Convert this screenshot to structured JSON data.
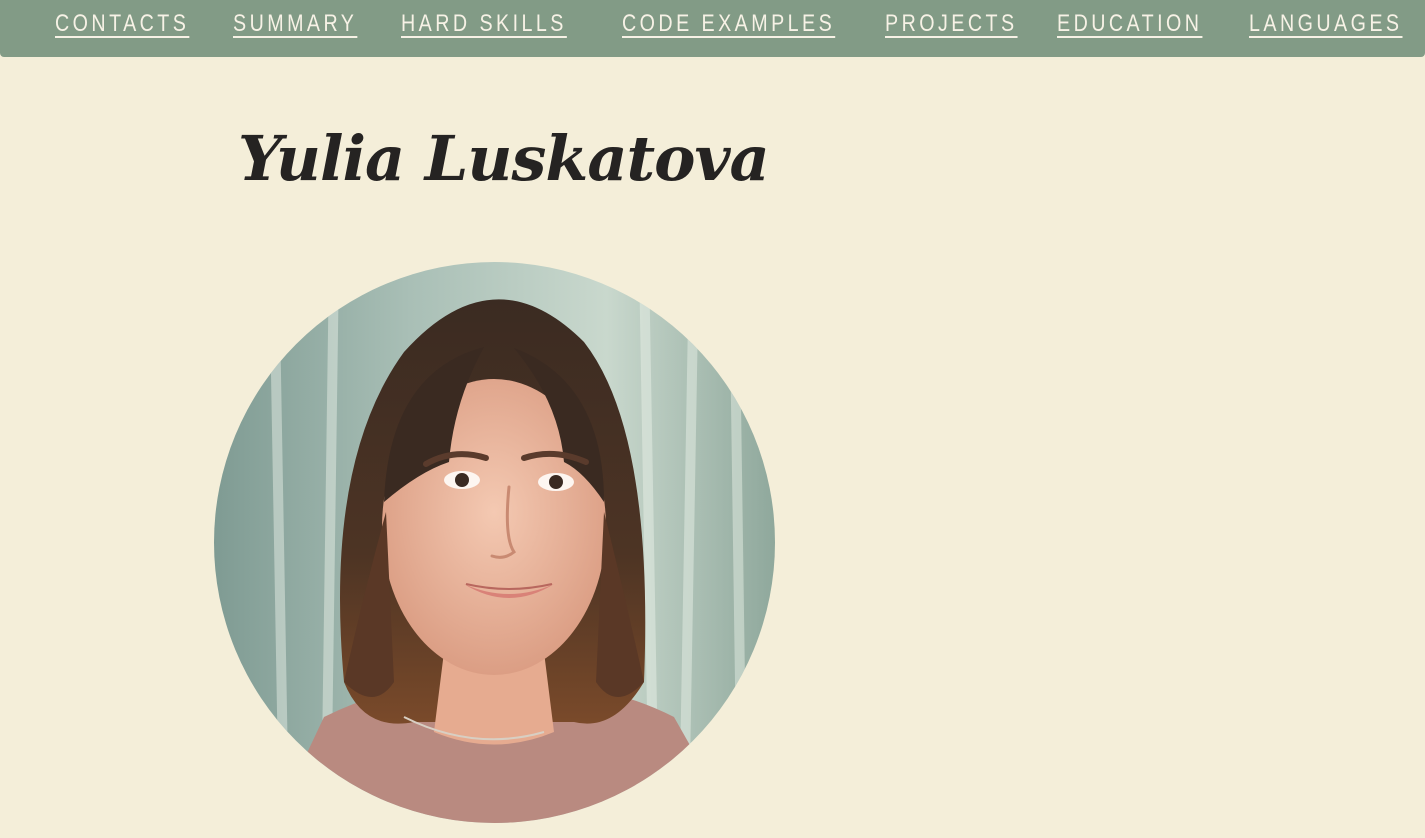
{
  "nav": {
    "items": [
      {
        "label": "CONTACTS"
      },
      {
        "label": "SUMMARY"
      },
      {
        "label": "HARD SKILLS"
      },
      {
        "label": "CODE EXAMPLES"
      },
      {
        "label": "PROJECTS"
      },
      {
        "label": "EDUCATION"
      },
      {
        "label": "LANGUAGES"
      }
    ]
  },
  "profile": {
    "name": "Yulia Luskatova"
  },
  "colors": {
    "nav_background": "#829b86",
    "page_background": "#f4eed9",
    "nav_text": "#f7f2e6",
    "heading_text": "#252322"
  }
}
